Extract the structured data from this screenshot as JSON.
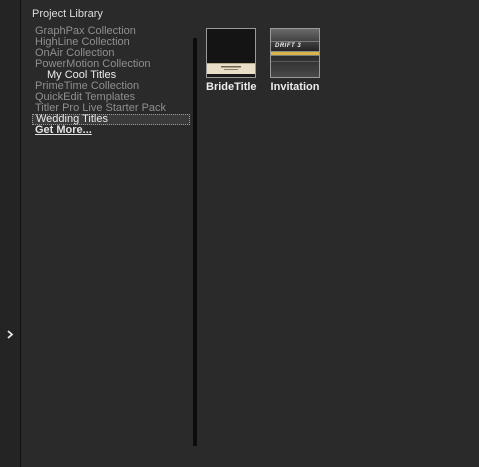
{
  "panel": {
    "title": "Project Library"
  },
  "library": {
    "items": [
      {
        "label": "GraphPax Collection"
      },
      {
        "label": "HighLine Collection"
      },
      {
        "label": "OnAir Collection"
      },
      {
        "label": "PowerMotion Collection"
      },
      {
        "label": "My Cool Titles"
      },
      {
        "label": "PrimeTime Collection"
      },
      {
        "label": "QuickEdit Templates"
      },
      {
        "label": "Titler Pro Live Starter Pack"
      },
      {
        "label": "Wedding Titles"
      },
      {
        "label": "Get More..."
      }
    ]
  },
  "titles": [
    {
      "name": "BrideTitle"
    },
    {
      "name": "Invitation",
      "graphic_text": "DRIFT 3"
    }
  ],
  "icons": {
    "expand": "chevron-right-icon"
  },
  "colors": {
    "background": "#2a2a2a",
    "rail": "#242424",
    "text_dim": "#8f8f8f",
    "text_bright": "#ececec"
  }
}
